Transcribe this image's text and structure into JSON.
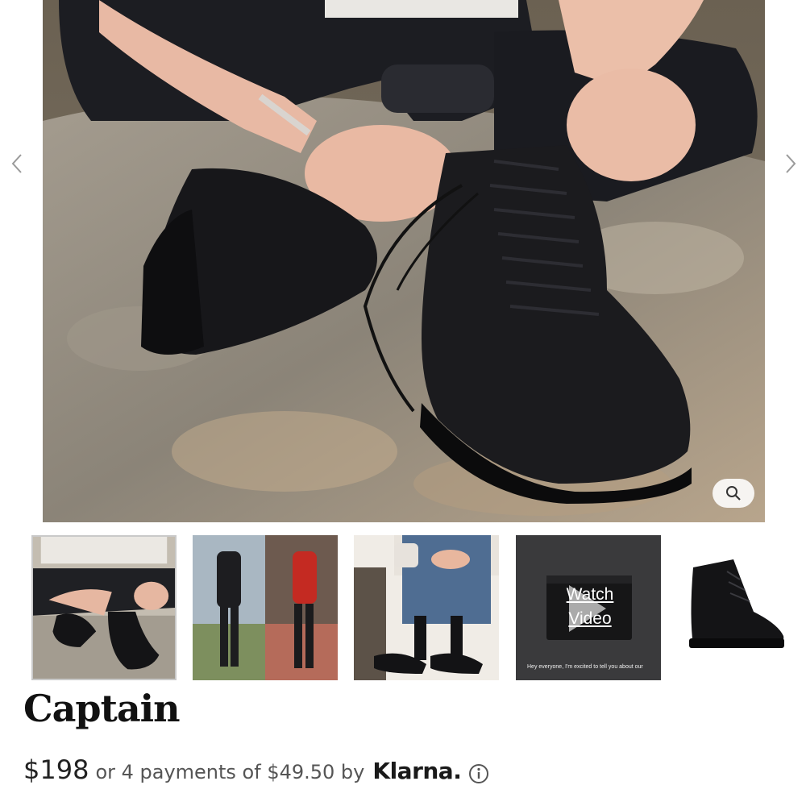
{
  "gallery": {
    "hero_image": "boots-lacing-on-rock-photo",
    "prev_icon": "chevron-left-icon",
    "next_icon": "chevron-right-icon",
    "zoom_icon": "magnifier-icon",
    "thumbnails": [
      {
        "image": "sitting-lacing-boots-photo"
      },
      {
        "image": "street-outfits-photo"
      },
      {
        "image": "seated-with-mug-photo"
      },
      {
        "image": "video-thumbnail",
        "label_line1": "Watch",
        "label_line2": "Video",
        "caption": "Hey everyone, I'm excited to tell you about our"
      },
      {
        "image": "boot-product-photo"
      }
    ]
  },
  "product": {
    "title": "Captain",
    "price": "$198",
    "installments_text": "or 4 payments of $49.50 by",
    "klarna_logo": "Klarna.",
    "info_icon": "info-circle-icon"
  },
  "colors": {
    "title": "#111111",
    "price": "#222222",
    "secondary_text": "#555555",
    "arrow": "#9a9a9a"
  }
}
